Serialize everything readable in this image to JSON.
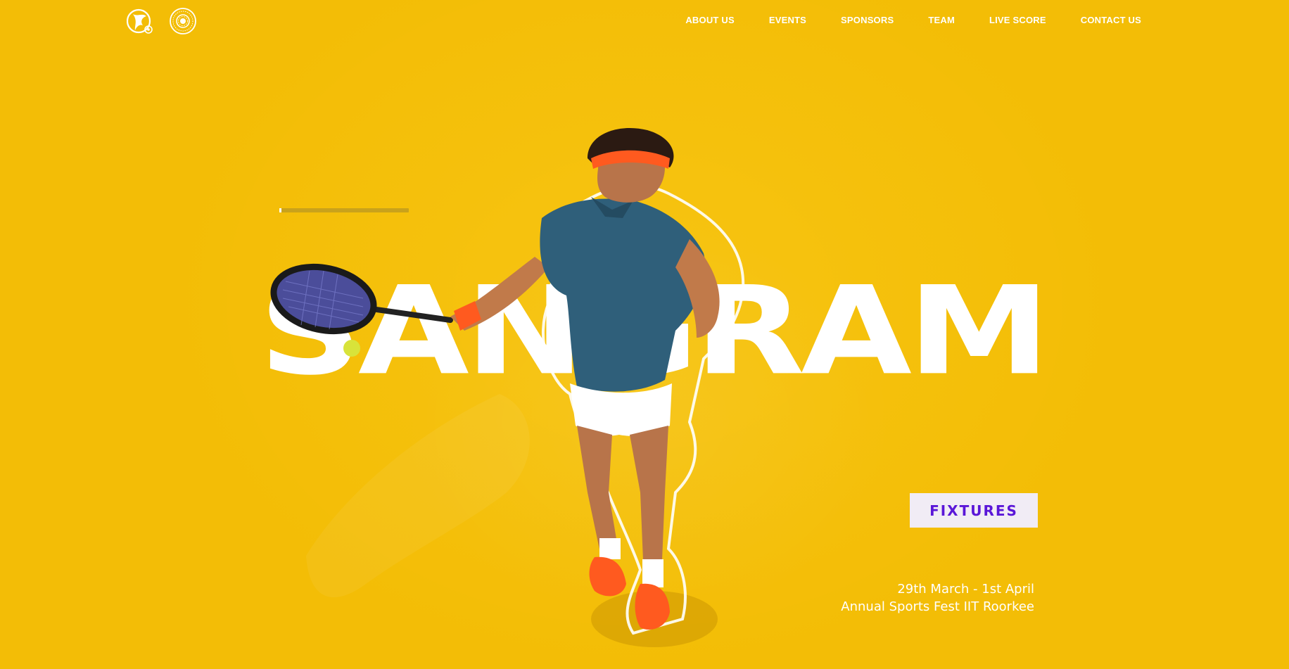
{
  "nav": {
    "logo_primary_icon": "sports-council-logo-icon",
    "logo_secondary_icon": "iit-roorkee-emblem-icon",
    "links": [
      {
        "label": "ABOUT US"
      },
      {
        "label": "EVENTS"
      },
      {
        "label": "SPONSORS"
      },
      {
        "label": "TEAM"
      },
      {
        "label": "LIVE SCORE"
      },
      {
        "label": "CONTACT US"
      }
    ]
  },
  "hero": {
    "title": "SANGRAM",
    "illustration_icon": "tennis-player-icon",
    "fixtures_label": "FIXTURES",
    "dates": "29th March - 1st April",
    "subtitle": "Annual Sports Fest IIT Roorkee"
  },
  "colors": {
    "background": "#f3bd06",
    "text": "#ffffff",
    "button_bg": "#f1ecf5",
    "button_text": "#5a16d8"
  }
}
